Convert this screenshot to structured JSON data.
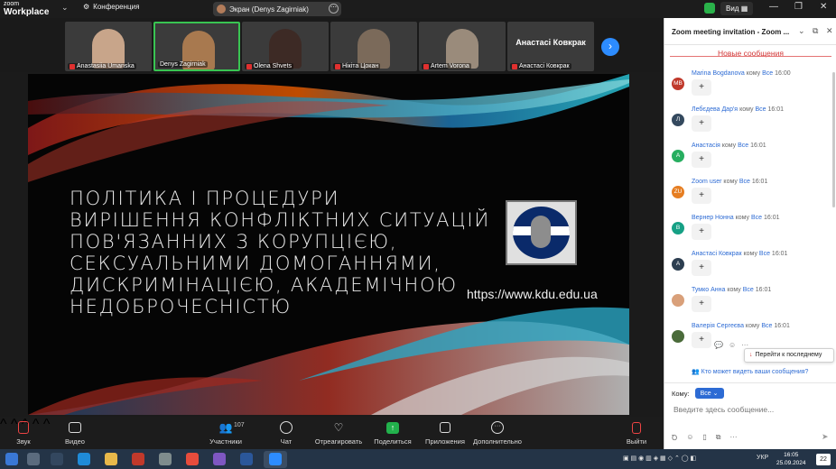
{
  "app": {
    "brand_top": "zoom",
    "brand_main": "Workplace",
    "conference_label": "Конференция",
    "screen_share_label": "Экран (Denys Zagirniak)",
    "view_label": "Вид"
  },
  "participants": [
    {
      "name": "Anastasiia Umanska",
      "muted": true,
      "active": false,
      "shade": "#c8a58a"
    },
    {
      "name": "Denys Zagirniak",
      "muted": false,
      "active": true,
      "shade": "#a8794f"
    },
    {
      "name": "Olena Shvets",
      "muted": true,
      "active": false,
      "shade": "#3d2a25"
    },
    {
      "name": "Нікіта Цокан",
      "muted": true,
      "active": false,
      "shade": "#7b6a5a"
    },
    {
      "name": "Artem Vorona",
      "muted": true,
      "active": false,
      "shade": "#9a8b7b"
    },
    {
      "name": "Анастасі Ковкрак",
      "muted": true,
      "active": false,
      "shade": "",
      "big_name": "Анастасі Ковкрак"
    }
  ],
  "slide": {
    "title": "ПОЛІТИКА І ПРОЦЕДУРИ\nВИРІШЕННЯ КОНФЛІКТНИХ СИТУАЦІЙ\nПОВ'ЯЗАННИХ З КОРУПЦІЄЮ,\nСЕКСУАЛЬНИМИ ДОМОГАННЯМИ,\nДИСКРИМІНАЦІЄЮ, АКАДЕМІЧНОЮ\nНЕДОБРОЧЕСНІСТЮ",
    "url": "https://www.kdu.edu.ua"
  },
  "toolbar": {
    "audio": "Звук",
    "video": "Видео",
    "participants": "Участники",
    "participants_count": "107",
    "chat": "Чат",
    "react": "Отреагировать",
    "share": "Поделиться",
    "apps": "Приложения",
    "more": "Дополнительно",
    "leave": "Выйти"
  },
  "chat": {
    "title": "Zoom meeting invitation - Zoom ...",
    "new_messages": "Новые сообщения",
    "to_word": "кому",
    "messages": [
      {
        "initials": "MB",
        "color": "#c0392b",
        "name": "Marina Bogdanova",
        "to": "Все",
        "time": "16:00",
        "text": "+"
      },
      {
        "initials": "Л",
        "color": "#34495e",
        "name": "Лебєдева Дар'я",
        "to": "Все",
        "time": "16:01",
        "text": "+"
      },
      {
        "initials": "А",
        "color": "#27ae60",
        "name": "Анастасія",
        "to": "Все",
        "time": "16:01",
        "text": "+"
      },
      {
        "initials": "ZU",
        "color": "#e67e22",
        "name": "Zoom user",
        "to": "Все",
        "time": "16:01",
        "text": "+"
      },
      {
        "initials": "В",
        "color": "#16a085",
        "name": "Вернер Нонна",
        "to": "Все",
        "time": "16:01",
        "text": "+"
      },
      {
        "initials": "А",
        "color": "#2c3e50",
        "name": "Анастасі Ковкрак",
        "to": "Все",
        "time": "16:01",
        "text": "+"
      },
      {
        "initials": "",
        "color": "#d9a07a",
        "name": "Тумко Анна",
        "to": "Все",
        "time": "16:01",
        "text": "+"
      },
      {
        "initials": "",
        "color": "#4a6b3a",
        "name": "Валерія Сергеєва",
        "to": "Все",
        "time": "16:01",
        "text": "+"
      }
    ],
    "jump_label": "Перейти к последнему",
    "who_sees": "Кто может видеть ваши сообщения?",
    "to_label": "Кому:",
    "to_value": "Все",
    "input_placeholder": "Введите здесь сообщение..."
  },
  "taskbar": {
    "lang": "УКР",
    "time": "16:05",
    "date": "25.09.2024",
    "notifications": "22"
  }
}
